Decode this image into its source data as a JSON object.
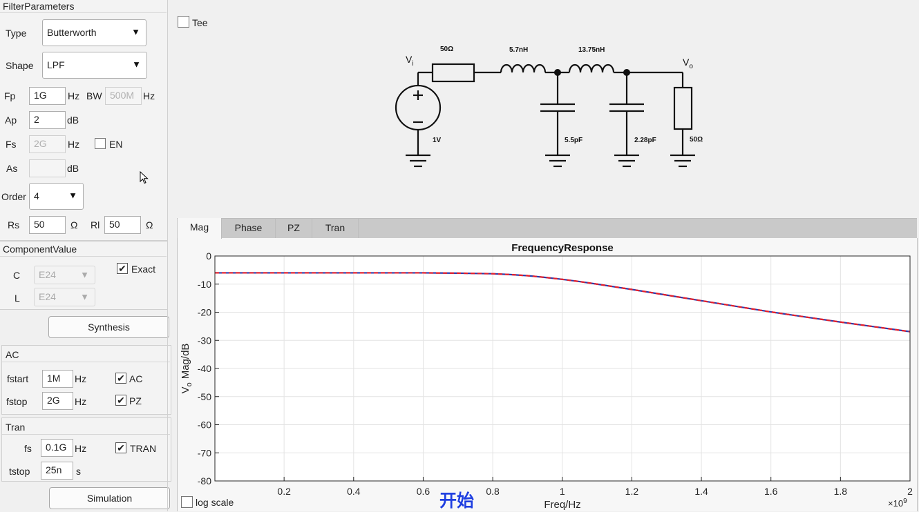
{
  "filter_params": {
    "title": "FilterParameters",
    "type_label": "Type",
    "type_value": "Butterworth",
    "shape_label": "Shape",
    "shape_value": "LPF",
    "fp_label": "Fp",
    "fp_value": "1G",
    "fp_unit": "Hz",
    "bw_label": "BW",
    "bw_value": "500M",
    "bw_unit": "Hz",
    "ap_label": "Ap",
    "ap_value": "2",
    "ap_unit": "dB",
    "fs_label": "Fs",
    "fs_value": "2G",
    "fs_unit": "Hz",
    "en_label": "EN",
    "as_label": "As",
    "as_value": "",
    "as_unit": "dB",
    "order_label": "Order",
    "order_value": "4",
    "rs_label": "Rs",
    "rs_value": "50",
    "rs_unit": "Ω",
    "rl_label": "Rl",
    "rl_value": "50",
    "rl_unit": "Ω"
  },
  "component_value": {
    "title": "ComponentValue",
    "c_label": "C",
    "c_value": "E24",
    "l_label": "L",
    "l_value": "E24",
    "exact_label": "Exact"
  },
  "synthesis_button": "Synthesis",
  "ac": {
    "title": "AC",
    "fstart_label": "fstart",
    "fstart_value": "1M",
    "fstart_unit": "Hz",
    "fstop_label": "fstop",
    "fstop_value": "2G",
    "fstop_unit": "Hz",
    "ac_label": "AC",
    "pz_label": "PZ"
  },
  "tran": {
    "title": "Tran",
    "fs_label": "fs",
    "fs_value": "0.1G",
    "fs_unit": "Hz",
    "tstop_label": "tstop",
    "tstop_value": "25n",
    "tstop_unit": "s",
    "tran_label": "TRAN"
  },
  "simulation_button": "Simulation",
  "tee_label": "Tee",
  "schematic": {
    "vi_main": "V",
    "vi_sub": "i",
    "vo_main": "V",
    "vo_sub": "o",
    "rs": "50Ω",
    "l1": "5.7nH",
    "l2": "13.75nH",
    "c1": "5.5pF",
    "c2": "2.28pF",
    "rl": "50Ω",
    "src": "1V"
  },
  "tabs": [
    "Mag",
    "Phase",
    "PZ",
    "Tran"
  ],
  "active_tab": "Mag",
  "log_scale_label": "log scale",
  "overlay_text": "开始",
  "chart_data": {
    "type": "line",
    "title": "FrequencyResponse",
    "xlabel": "Freq/Hz",
    "ylabel_main": "V",
    "ylabel_sub": "o",
    "ylabel_rest": "Mag/dB",
    "x_multiplier_base": "×10",
    "x_multiplier_exp": "9",
    "xlim": [
      0.001,
      2
    ],
    "ylim": [
      -80,
      0
    ],
    "xticks": [
      0.2,
      0.4,
      0.6,
      0.8,
      1,
      1.2,
      1.4,
      1.6,
      1.8,
      2
    ],
    "yticks": [
      0,
      -10,
      -20,
      -30,
      -40,
      -50,
      -60,
      -70,
      -80
    ],
    "grid": true,
    "series": [
      {
        "color": "#e8202a",
        "dashed": true,
        "x": [
          0.001,
          0.2,
          0.4,
          0.6,
          0.7,
          0.8,
          0.85,
          0.9,
          0.95,
          1.0,
          1.05,
          1.1,
          1.2,
          1.3,
          1.4,
          1.5,
          1.6,
          1.7,
          1.8,
          1.9,
          2.0
        ],
        "y": [
          -6.0,
          -6.0,
          -6.0,
          -6.0,
          -6.1,
          -6.3,
          -6.6,
          -7.0,
          -7.6,
          -8.3,
          -9.1,
          -10.0,
          -11.9,
          -13.9,
          -15.9,
          -17.9,
          -19.9,
          -21.7,
          -23.5,
          -25.2,
          -26.9
        ]
      },
      {
        "color": "#2f3aa8",
        "dashed": false,
        "x": [
          0.001,
          0.2,
          0.4,
          0.6,
          0.7,
          0.8,
          0.85,
          0.9,
          0.95,
          1.0,
          1.05,
          1.1,
          1.2,
          1.3,
          1.4,
          1.5,
          1.6,
          1.7,
          1.8,
          1.9,
          2.0
        ],
        "y": [
          -6.0,
          -6.0,
          -6.0,
          -6.0,
          -6.1,
          -6.3,
          -6.6,
          -7.0,
          -7.6,
          -8.3,
          -9.1,
          -10.0,
          -11.9,
          -13.9,
          -15.9,
          -17.9,
          -19.9,
          -21.7,
          -23.5,
          -25.2,
          -26.9
        ]
      }
    ]
  },
  "colors": {
    "tab_bar": "#c9c9c9",
    "panel_bg": "#f3f3f3",
    "overlay_text": "#1f3fe0"
  }
}
